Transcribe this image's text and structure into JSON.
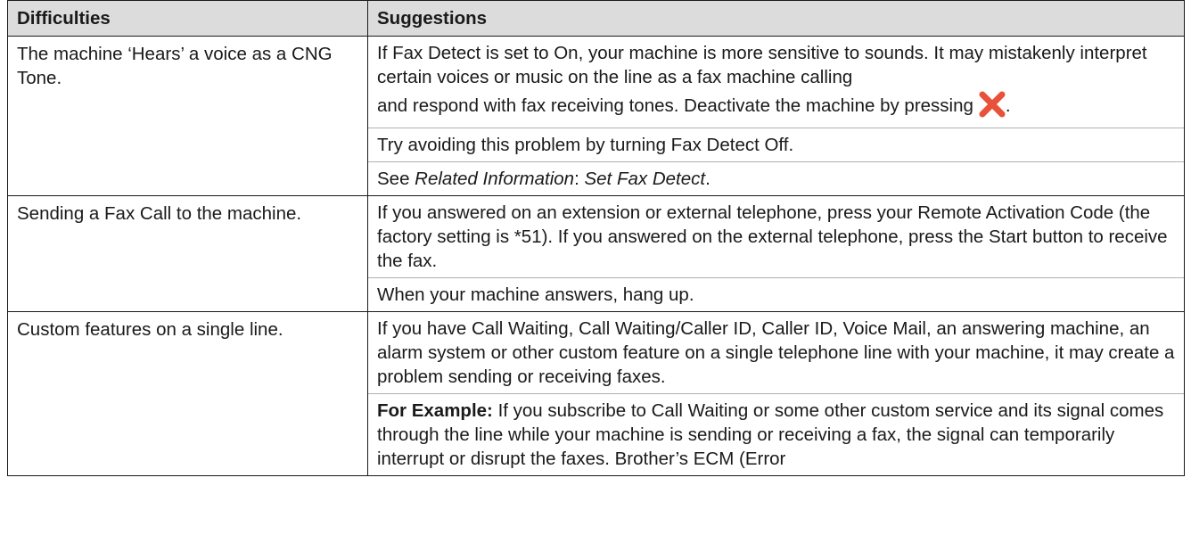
{
  "headers": {
    "difficulties": "Difficulties",
    "suggestions": "Suggestions"
  },
  "rows": [
    {
      "difficulty": "The machine ‘Hears’ a voice as a CNG Tone.",
      "s1": "If Fax Detect is set to On, your machine is more sensitive to sounds. It may mistakenly interpret certain voices or music on the line as a fax machine calling",
      "s1b": "and respond with fax receiving tones. Deactivate the machine by pressing",
      "s1c": ".",
      "s2": "Try avoiding this problem by turning Fax Detect Off.",
      "s3_prefix": "See ",
      "s3_link1": "Related Information",
      "s3_sep": ": ",
      "s3_link2": "Set Fax Detect",
      "s3_end": "."
    },
    {
      "difficulty": "Sending a Fax Call to the machine.",
      "s1": "If you answered on an extension or external telephone, press your Remote Activation Code (the factory setting is *51). If you answered on the external telephone, press the Start button to receive the fax.",
      "s2": "When your machine answers, hang up."
    },
    {
      "difficulty": "Custom features on a single line.",
      "s1": "If you have Call Waiting, Call Waiting/Caller ID, Caller ID, Voice Mail, an answering machine, an alarm system or other custom feature on a single telephone line with your machine, it may create a problem sending or receiving faxes.",
      "s2_bold": "For Example:",
      "s2": " If you subscribe to Call Waiting or some other custom service and its signal comes through the line while your machine is sending or receiving a fax, the signal can temporarily interrupt or disrupt the faxes. Brother’s ECM (Error"
    }
  ],
  "icons": {
    "cancel": "cancel-x-icon",
    "cancel_color": "#e8513a"
  }
}
